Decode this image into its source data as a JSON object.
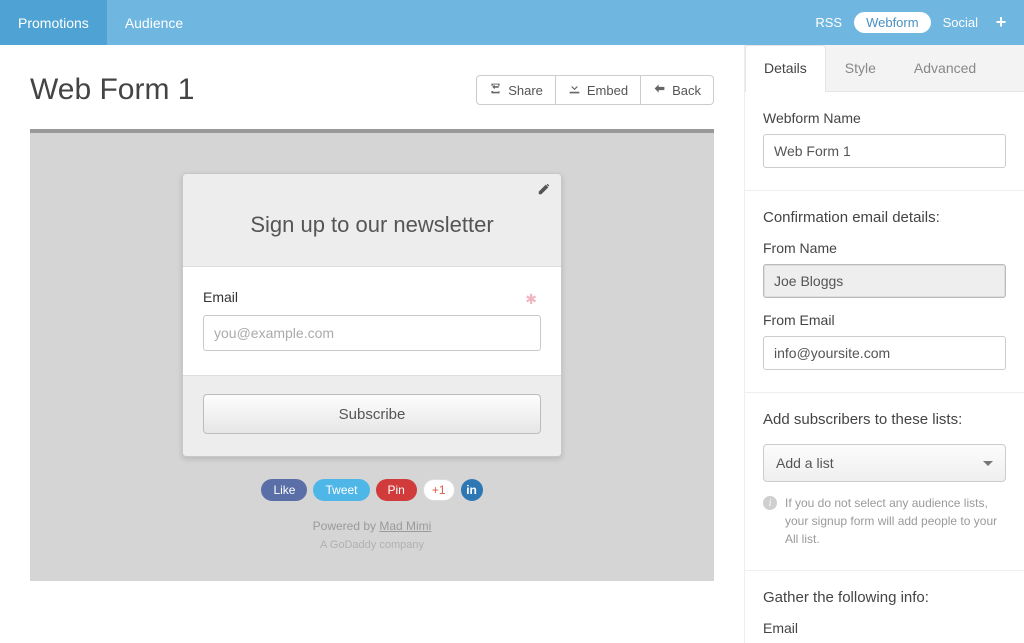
{
  "topnav": {
    "left": [
      {
        "label": "Promotions",
        "active": true
      },
      {
        "label": "Audience",
        "active": false
      }
    ],
    "right": {
      "rss": "RSS",
      "webform": "Webform",
      "social": "Social"
    }
  },
  "page": {
    "title": "Web Form 1",
    "actions": {
      "share": "Share",
      "embed": "Embed",
      "back": "Back"
    }
  },
  "preview": {
    "form_title": "Sign up to our newsletter",
    "email_label": "Email",
    "email_placeholder": "you@example.com",
    "subscribe": "Subscribe",
    "social": {
      "like": "Like",
      "tweet": "Tweet",
      "pin": "Pin",
      "plus1": "+1",
      "in": "in"
    },
    "powered_prefix": "Powered by ",
    "powered_link": "Mad Mimi",
    "powered_sub": "A GoDaddy company"
  },
  "sidebar": {
    "tabs": {
      "details": "Details",
      "style": "Style",
      "advanced": "Advanced"
    },
    "webform_name_label": "Webform Name",
    "webform_name_value": "Web Form 1",
    "confirmation_heading": "Confirmation email details:",
    "from_name_label": "From Name",
    "from_name_value": "Joe Bloggs",
    "from_email_label": "From Email",
    "from_email_value": "info@yoursite.com",
    "lists_heading": "Add subscribers to these lists:",
    "add_list_label": "Add a list",
    "lists_hint": "If you do not select any audience lists, your signup form will add people to your All list.",
    "gather_heading": "Gather the following info:",
    "gather_email": "Email"
  }
}
